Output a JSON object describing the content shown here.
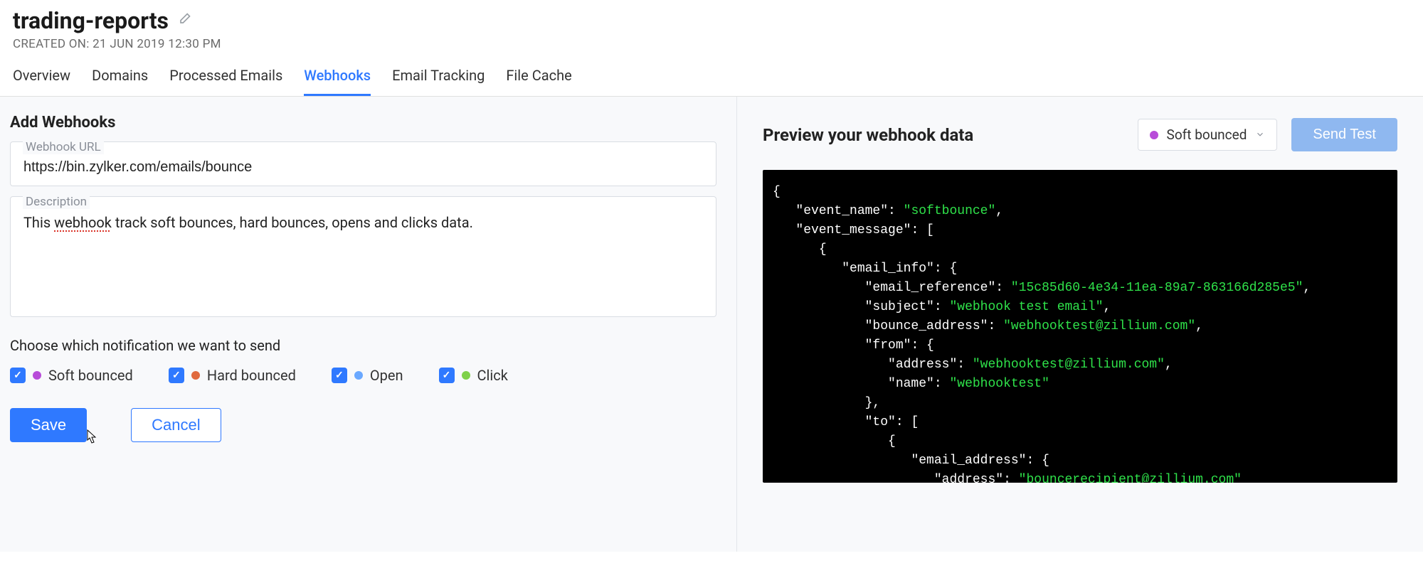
{
  "header": {
    "title": "trading-reports",
    "created_on": "CREATED ON: 21 JUN 2019 12:30 PM"
  },
  "tabs": {
    "overview": "Overview",
    "domains": "Domains",
    "processed_emails": "Processed Emails",
    "webhooks": "Webhooks",
    "email_tracking": "Email Tracking",
    "file_cache": "File Cache"
  },
  "form": {
    "section_title": "Add Webhooks",
    "url_label": "Webhook URL",
    "url_value": "https://bin.zylker.com/emails/bounce",
    "desc_label": "Description",
    "desc_prefix": "This ",
    "desc_misspell": "webhook",
    "desc_suffix": " track soft bounces, hard bounces, opens and clicks data.",
    "choose_label": "Choose which notification we want to send",
    "options": {
      "soft": "Soft bounced",
      "hard": "Hard bounced",
      "open": "Open",
      "click": "Click"
    },
    "save": "Save",
    "cancel": "Cancel"
  },
  "preview": {
    "title": "Preview your webhook data",
    "dropdown_selected": "Soft bounced",
    "send_test": "Send Test",
    "json": {
      "event_name": "softbounce",
      "email_reference": "15c85d60-4e34-11ea-89a7-863166d285e5",
      "subject": "webhook test email",
      "bounce_address": "webhooktest@zillium.com",
      "from_address": "webhooktest@zillium.com",
      "from_name": "webhooktest",
      "to_address": "bouncerecipient@zillium.com"
    }
  }
}
